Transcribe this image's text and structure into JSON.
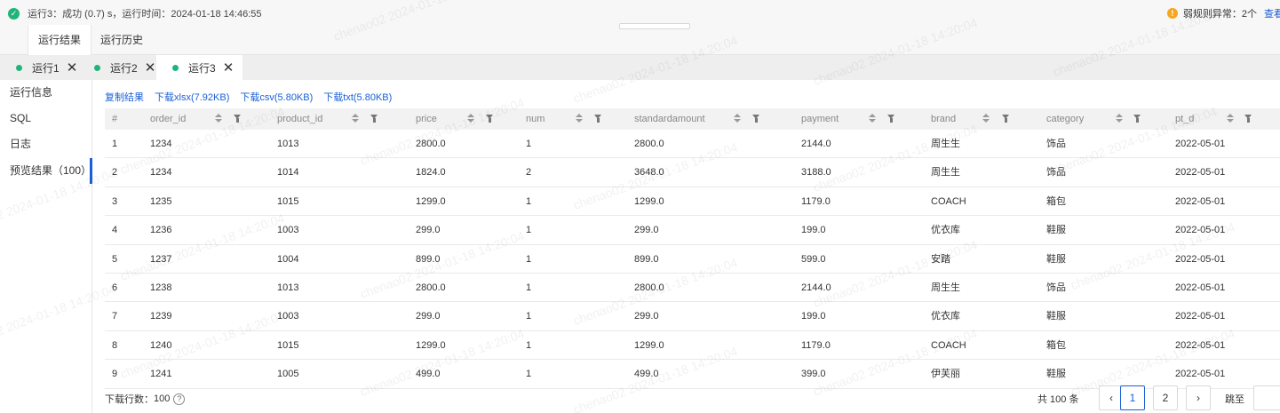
{
  "status": {
    "text": "运行3：成功 (0.7) s，运行时间：2024-01-18 14:46:55",
    "warning": "弱规则异常：2个",
    "view_link": "查看"
  },
  "result_tabs": [
    "运行结果",
    "运行历史"
  ],
  "run_tabs": [
    "运行1",
    "运行2",
    "运行3"
  ],
  "sidebar": [
    "运行信息",
    "SQL",
    "日志",
    "预览结果（100）"
  ],
  "actions": [
    "复制结果",
    "下载xlsx(7.92KB)",
    "下载csv(5.80KB)",
    "下载txt(5.80KB)"
  ],
  "columns": [
    "#",
    "order_id",
    "product_id",
    "price",
    "num",
    "standardamount",
    "payment",
    "brand",
    "category",
    "pt_d"
  ],
  "rows": [
    [
      "1",
      "1234",
      "1013",
      "2800.0",
      "1",
      "2800.0",
      "2144.0",
      "周生生",
      "饰品",
      "2022-05-01"
    ],
    [
      "2",
      "1234",
      "1014",
      "1824.0",
      "2",
      "3648.0",
      "3188.0",
      "周生生",
      "饰品",
      "2022-05-01"
    ],
    [
      "3",
      "1235",
      "1015",
      "1299.0",
      "1",
      "1299.0",
      "1179.0",
      "COACH",
      "箱包",
      "2022-05-01"
    ],
    [
      "4",
      "1236",
      "1003",
      "299.0",
      "1",
      "299.0",
      "199.0",
      "优衣库",
      "鞋服",
      "2022-05-01"
    ],
    [
      "5",
      "1237",
      "1004",
      "899.0",
      "1",
      "899.0",
      "599.0",
      "安踏",
      "鞋服",
      "2022-05-01"
    ],
    [
      "6",
      "1238",
      "1013",
      "2800.0",
      "1",
      "2800.0",
      "2144.0",
      "周生生",
      "饰品",
      "2022-05-01"
    ],
    [
      "7",
      "1239",
      "1003",
      "299.0",
      "1",
      "299.0",
      "199.0",
      "优衣库",
      "鞋服",
      "2022-05-01"
    ],
    [
      "8",
      "1240",
      "1015",
      "1299.0",
      "1",
      "1299.0",
      "1179.0",
      "COACH",
      "箱包",
      "2022-05-01"
    ],
    [
      "9",
      "1241",
      "1005",
      "499.0",
      "1",
      "499.0",
      "399.0",
      "伊芙丽",
      "鞋服",
      "2022-05-01"
    ]
  ],
  "footer": {
    "download_rows_label": "下载行数：",
    "download_rows_value": "100",
    "help_glyph": "?",
    "total": "共 100 条",
    "prev_glyph": "‹",
    "pages": [
      "1",
      "2"
    ],
    "next_glyph": "›",
    "jump_label": "跳至"
  },
  "watermark": "chenao02 2024-01-18 14:20:04",
  "colors": {
    "accent": "#1a5fd6",
    "success": "#1fb57a",
    "warning": "#f5a623"
  }
}
